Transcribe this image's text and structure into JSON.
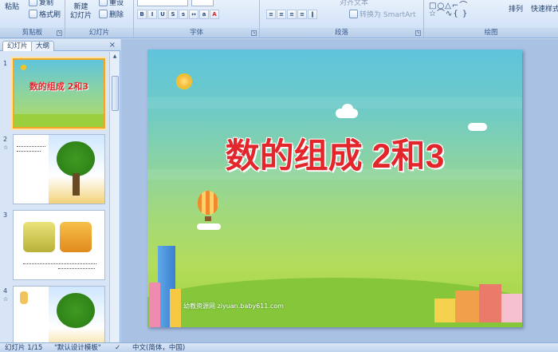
{
  "ribbon": {
    "clipboard": {
      "paste_label": "粘贴",
      "copy_label": "复制",
      "format_painter_label": "格式刷",
      "group_label": "剪贴板"
    },
    "slides": {
      "new_slide_label": "新建",
      "new_slide_label2": "幻灯片",
      "reset_label": "重设",
      "delete_label": "删除",
      "group_label": "幻灯片"
    },
    "font": {
      "group_label": "字体"
    },
    "paragraph": {
      "align_text_label": "对齐文本",
      "smartart_label": "转换为 SmartArt",
      "group_label": "段落"
    },
    "drawing": {
      "arrange_label": "排列",
      "quick_styles_label": "快速样式",
      "group_label": "绘图"
    }
  },
  "left_panel": {
    "tabs": [
      "幻灯片",
      "大纲"
    ],
    "close_label": "×",
    "thumbnails": [
      {
        "number": "1",
        "title": "数的组成 2和3"
      },
      {
        "number": "2"
      },
      {
        "number": "3"
      },
      {
        "number": "4"
      }
    ]
  },
  "slide": {
    "title": "数的组成 2和3",
    "watermark": "幼教资源网 ziyuan.baby611.com"
  },
  "status_bar": {
    "slide_counter": "幻灯片 1/15",
    "theme": "\"默认设计模板\"",
    "language": "中文(简体，中国)"
  },
  "colors": {
    "title_red": "#e3262c",
    "selection_orange": "#f5a623"
  }
}
